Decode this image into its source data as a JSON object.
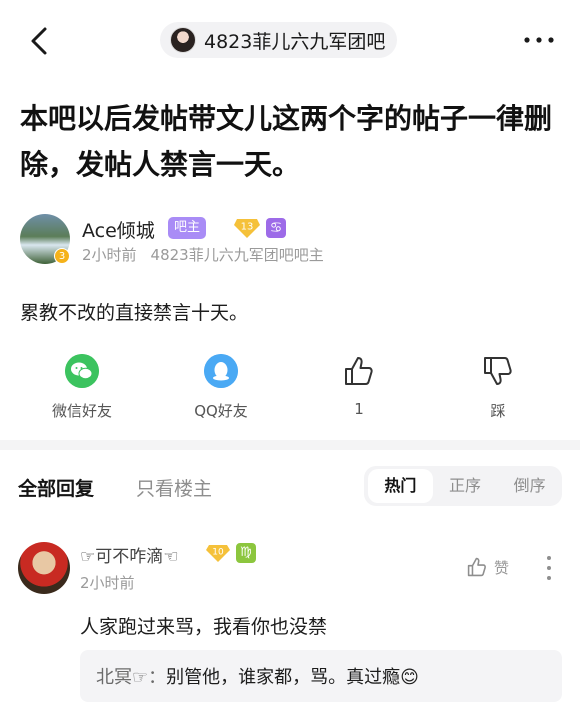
{
  "header": {
    "back_icon": "chevron-left-icon",
    "forum_name": "4823菲儿六九军团吧",
    "more_icon": "ellipsis-icon"
  },
  "post": {
    "title": "本吧以后发帖带文儿这两个字的帖子一律删除，发帖人禁言一天。",
    "author": {
      "name": "Ace倾城",
      "avatar_level": "3",
      "role_badge": "吧主",
      "level_badge": "13",
      "sign_badge": "♋",
      "time": "2小时前",
      "role_desc": "4823菲儿六九军团吧吧主"
    },
    "body": "累教不改的直接禁言十天。"
  },
  "actions": {
    "wechat_label": "微信好友",
    "qq_label": "QQ好友",
    "like_count": "1",
    "dislike_label": "踩"
  },
  "reply_tabs": {
    "all": "全部回复",
    "owner_only": "只看楼主",
    "sort_options": [
      "热门",
      "正序",
      "倒序"
    ]
  },
  "replies": [
    {
      "name": "☞可不咋滴☜",
      "level_badge": "10",
      "sign_badge": "♍",
      "time": "2小时前",
      "like_label": "赞",
      "content": "人家跑过来骂，我看你也没禁",
      "subreply": {
        "name": "北冥☞",
        "separator": "：",
        "text": "别管他，谁家都，骂。真过瘾😊"
      }
    }
  ],
  "colors": {
    "admin_badge": "#a98cf6",
    "wechat": "#3cc35f",
    "qq": "#4aa9f4",
    "level_gold": "#f5b21a"
  }
}
